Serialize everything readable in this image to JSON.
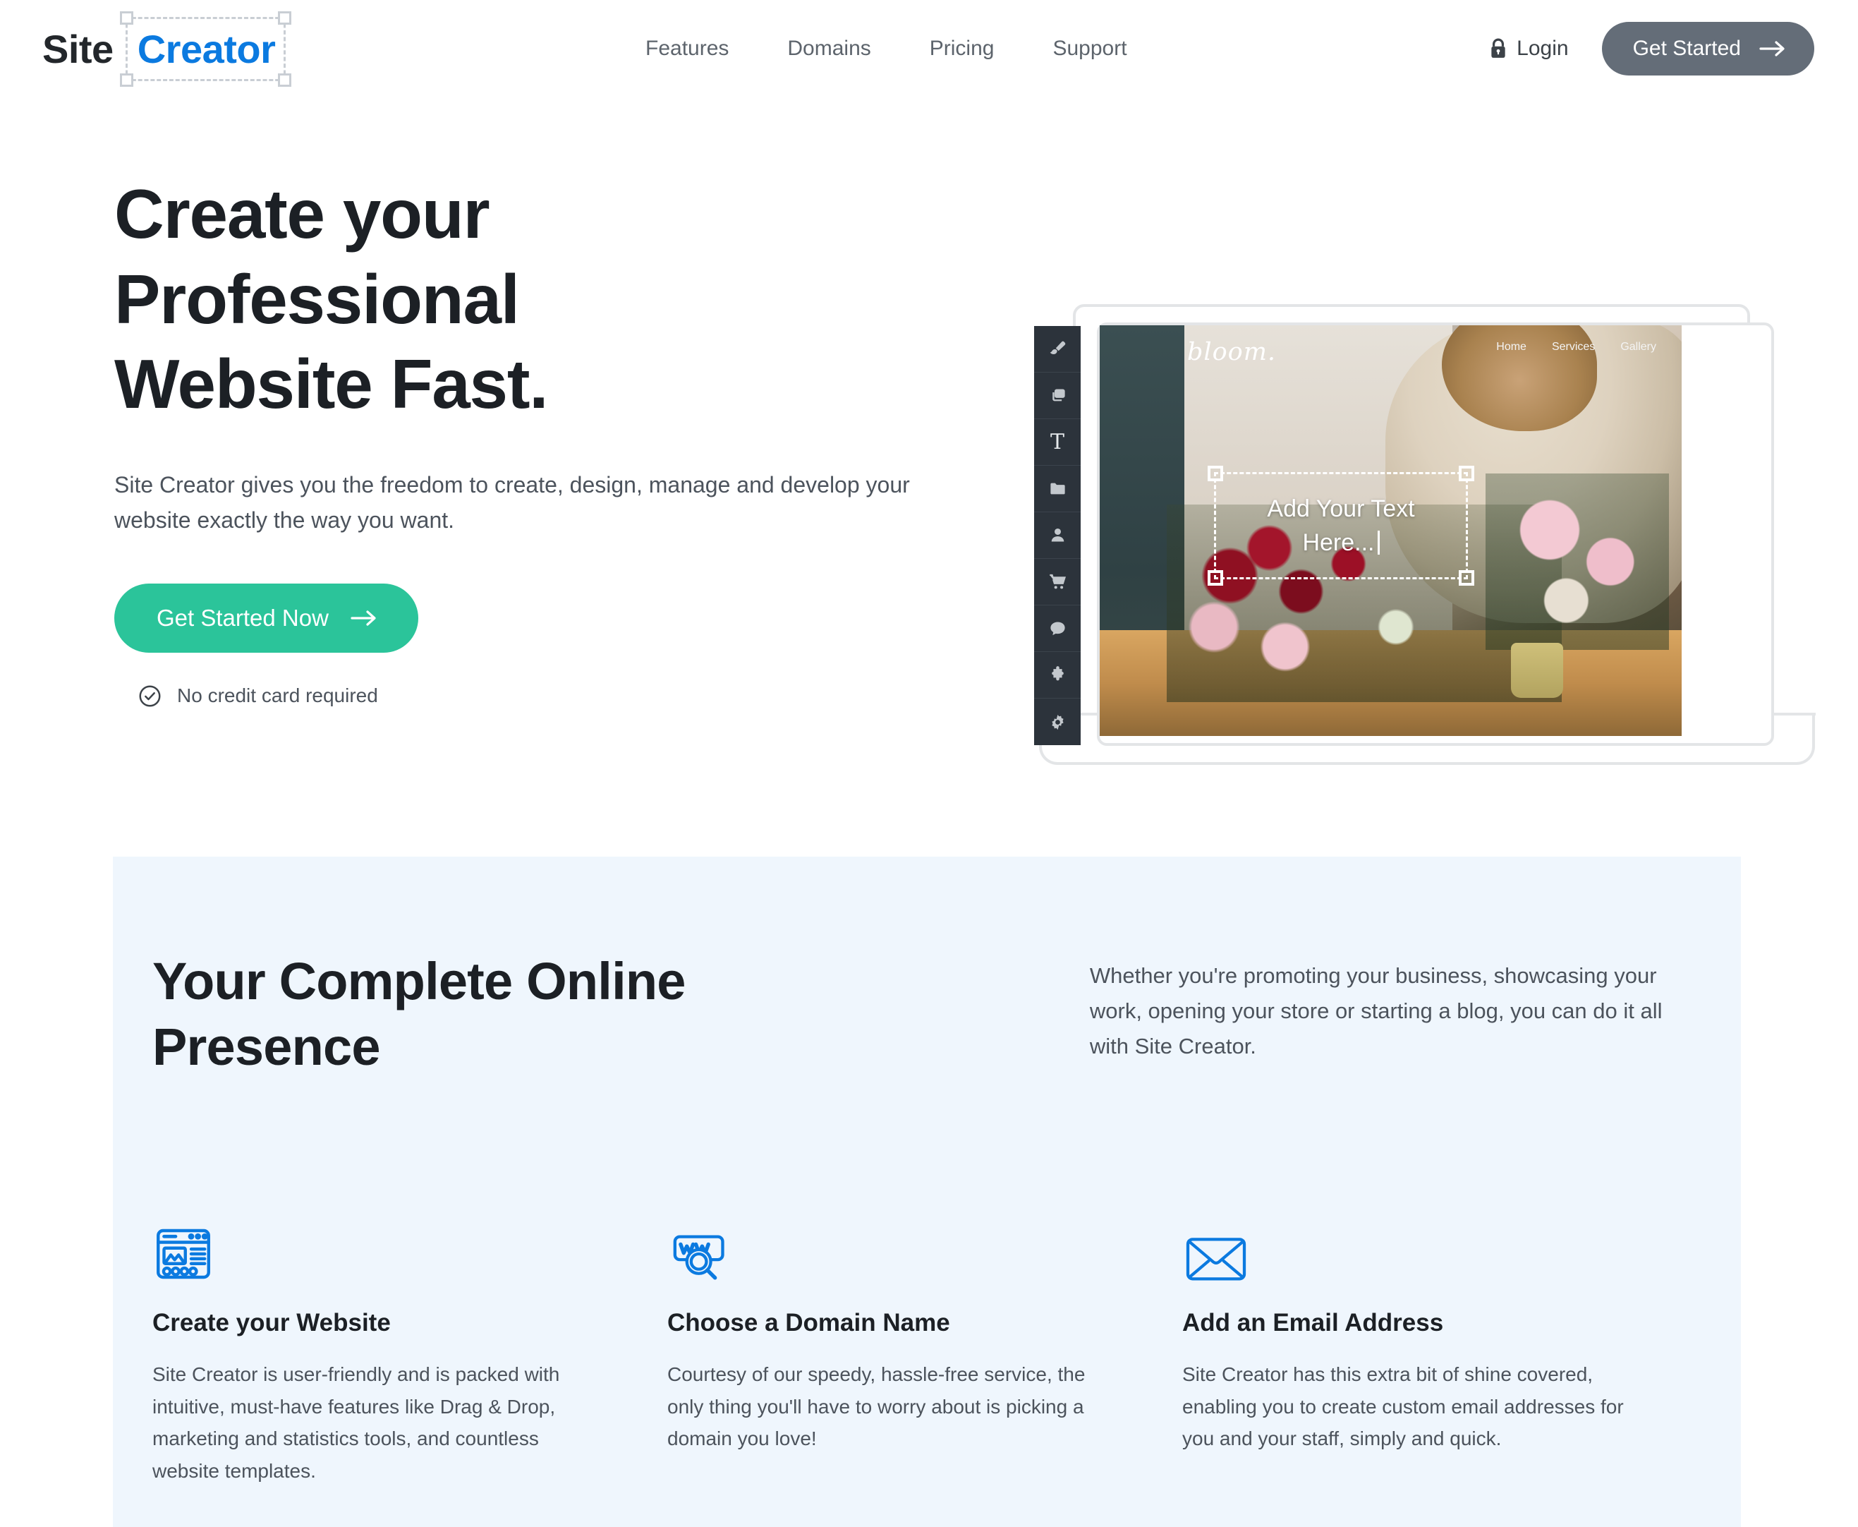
{
  "header": {
    "logo": {
      "part1": "Site",
      "part2": "Creator"
    },
    "nav": [
      {
        "label": "Features"
      },
      {
        "label": "Domains"
      },
      {
        "label": "Pricing"
      },
      {
        "label": "Support"
      }
    ],
    "login_label": "Login",
    "cta_label": "Get Started"
  },
  "hero": {
    "title_line1": "Create your",
    "title_line2": "Professional",
    "title_line3": "Website Fast.",
    "subtitle": "Site Creator gives you the freedom to create, design, manage and develop your website exactly the way you want.",
    "cta_label": "Get Started Now",
    "note": "No credit card required"
  },
  "mockup": {
    "site_logo": "bloom.",
    "site_nav": [
      {
        "label": "Home"
      },
      {
        "label": "Services"
      },
      {
        "label": "Gallery"
      }
    ],
    "textbox_line1": "Add Your Text",
    "textbox_line2": "Here...",
    "toolbar": [
      {
        "icon": "brush-icon"
      },
      {
        "icon": "layers-icon"
      },
      {
        "icon": "text-icon",
        "glyph": "T"
      },
      {
        "icon": "folder-icon"
      },
      {
        "icon": "person-icon"
      },
      {
        "icon": "cart-icon"
      },
      {
        "icon": "chat-icon"
      },
      {
        "icon": "puzzle-icon"
      },
      {
        "icon": "gear-icon"
      }
    ]
  },
  "presence": {
    "title_line1": "Your Complete Online",
    "title_line2": "Presence",
    "copy": "Whether you're promoting your business, showcasing your work, opening your store or starting a blog, you can do it all with Site Creator.",
    "features": [
      {
        "icon": "website-layout-icon",
        "title": "Create your Website",
        "text": "Site Creator is user-friendly and is packed with intuitive, must-have features like Drag & Drop, marketing and statistics tools, and countless website templates."
      },
      {
        "icon": "domain-search-icon",
        "title": "Choose a Domain Name",
        "text": "Courtesy of our speedy, hassle-free service, the only thing you'll have to worry about is picking a domain you love!"
      },
      {
        "icon": "email-envelope-icon",
        "title": "Add an Email Address",
        "text": "Site Creator has this extra bit of shine covered, enabling you to create custom email addresses for you and your staff, simply and quick."
      }
    ]
  },
  "colors": {
    "brand_blue": "#0b7ae0",
    "accent_green": "#2bc49a",
    "header_button": "#646d78",
    "section_bg": "#eff6fd",
    "toolbar_bg": "#2c333b"
  }
}
